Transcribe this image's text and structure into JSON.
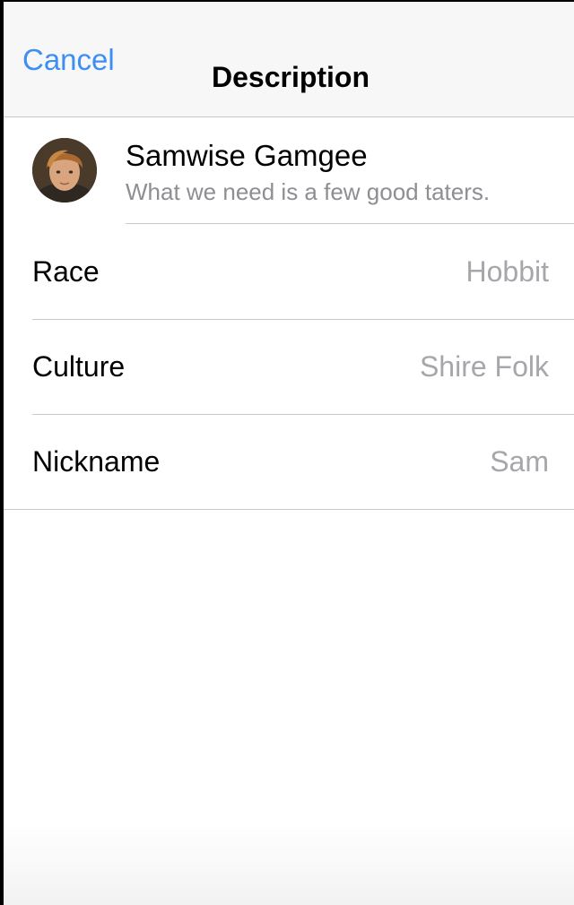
{
  "navbar": {
    "cancel_label": "Cancel",
    "title": "Description"
  },
  "profile": {
    "name": "Samwise Gamgee",
    "quote": "What we need is a few good taters."
  },
  "details": [
    {
      "label": "Race",
      "value": "Hobbit"
    },
    {
      "label": "Culture",
      "value": "Shire Folk"
    },
    {
      "label": "Nickname",
      "value": "Sam"
    }
  ],
  "colors": {
    "accent": "#3d8ef5",
    "secondary_text": "#8e8e93",
    "separator": "#c8c7cc"
  }
}
